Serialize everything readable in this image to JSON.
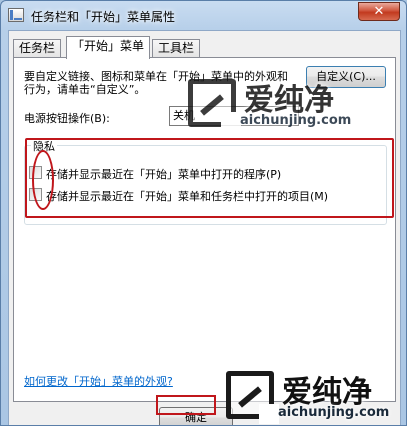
{
  "window": {
    "title": "任务栏和「开始」菜单属性",
    "close_glyph": "✕"
  },
  "tabs": [
    {
      "label": "任务栏",
      "active": false
    },
    {
      "label": "「开始」菜单",
      "active": true
    },
    {
      "label": "工具栏",
      "active": false
    }
  ],
  "panel": {
    "description": "要自定义链接、图标和菜单在「开始」菜单中的外观和行为，请单击“自定义”。",
    "customize_button": "自定义(C)...",
    "power_label": "电源按钮操作(B):",
    "power_value": "关机"
  },
  "privacy": {
    "title": "隐私",
    "items": [
      {
        "label": "存储并显示最近在「开始」菜单中打开的程序(P)",
        "checked": false
      },
      {
        "label": "存储并显示最近在「开始」菜单和任务栏中打开的项目(M)",
        "checked": false
      }
    ]
  },
  "help_link": "如何更改「开始」菜单的外观?",
  "ok_button": "确定",
  "watermark": {
    "name": "爱纯净",
    "domain": "aichunjing.com"
  },
  "colors": {
    "annotation": "#c0161b",
    "link": "#0066cc"
  }
}
